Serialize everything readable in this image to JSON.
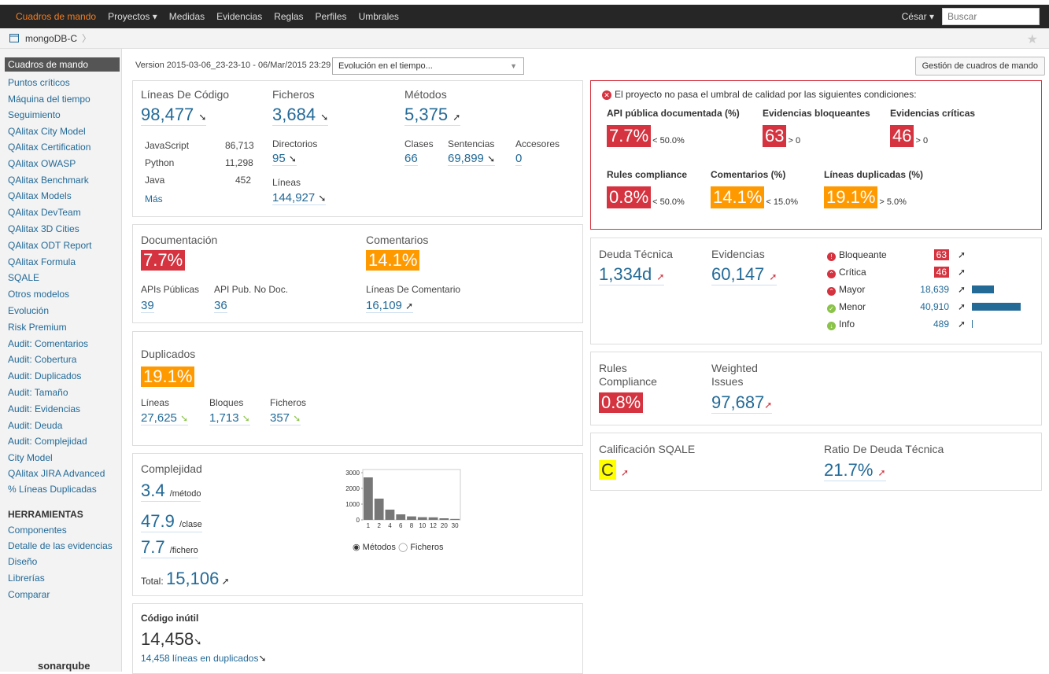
{
  "nav": {
    "home": "Cuadros de mando",
    "items": [
      "Proyectos ▾",
      "Medidas",
      "Evidencias",
      "Reglas",
      "Perfiles",
      "Umbrales"
    ],
    "user": "César ▾",
    "search_placeholder": "Buscar"
  },
  "breadcrumb": {
    "project": "mongoDB-C"
  },
  "sidebar": {
    "items": [
      "Cuadros de mando",
      "Puntos críticos",
      "Máquina del tiempo",
      "Seguimiento",
      "QAlitax City Model",
      "QAlitax Certification",
      "QAlitax OWASP",
      "QAlitax Benchmark",
      "QAlitax Models",
      "QAlitax DevTeam",
      "QAlitax 3D Cities",
      "QAlitax ODT Report",
      "QAlitax Formula",
      "SQALE",
      "Otros modelos",
      "Evolución",
      "Risk Premium",
      "Audit: Comentarios",
      "Audit: Cobertura",
      "Audit: Duplicados",
      "Audit: Tamaño",
      "Audit: Evidencias",
      "Audit: Deuda",
      "Audit: Complejidad",
      "City Model",
      "QAlitax JIRA Advanced",
      "% Líneas Duplicadas"
    ],
    "tools_title": "HERRAMIENTAS",
    "tools": [
      "Componentes",
      "Detalle de las evidencias",
      "Diseño",
      "Librerías",
      "Comparar"
    ],
    "logo": "sonarqube"
  },
  "toolbar": {
    "version": "Version 2015-03-06_23-23-10 - 06/Mar/2015 23:29",
    "select": "Evolución en el tiempo...",
    "manage": "Gestión de cuadros de mando"
  },
  "size": {
    "loc_label": "Líneas De Código",
    "loc": "98,477",
    "files_label": "Ficheros",
    "files": "3,684",
    "methods_label": "Métodos",
    "methods": "5,375",
    "langs": [
      {
        "name": "JavaScript",
        "value": "86,713"
      },
      {
        "name": "Python",
        "value": "11,298"
      },
      {
        "name": "Java",
        "value": "452"
      }
    ],
    "more": "Más",
    "dirs_label": "Directorios",
    "dirs": "95",
    "lines_label": "Líneas",
    "lines": "144,927",
    "classes_label": "Clases",
    "classes": "66",
    "stmts_label": "Sentencias",
    "stmts": "69,899",
    "acc_label": "Accesores",
    "acc": "0"
  },
  "doc": {
    "title": "Documentación",
    "value": "7.7%",
    "comments_title": "Comentarios",
    "comments": "14.1%",
    "api_label": "APIs Públicas",
    "api": "39",
    "undoc_label": "API Pub. No Doc.",
    "undoc": "36",
    "comment_lines_label": "Líneas De Comentario",
    "comment_lines": "16,109"
  },
  "dup": {
    "title": "Duplicados",
    "value": "19.1%",
    "lines_label": "Líneas",
    "lines": "27,625",
    "blocks_label": "Bloques",
    "blocks": "1,713",
    "files_label": "Ficheros",
    "files": "357"
  },
  "complexity": {
    "title": "Complejidad",
    "per_method": "3.4",
    "per_method_unit": "/método",
    "per_class": "47.9",
    "per_class_unit": "/clase",
    "per_file": "7.7",
    "per_file_unit": "/fichero",
    "total_label": "Total:",
    "total": "15,106",
    "radio1": "Métodos",
    "radio2": "Ficheros"
  },
  "dead": {
    "title": "Código inútil",
    "value": "14,458",
    "dup_lines": "14,458 líneas en duplicados"
  },
  "alert": {
    "message": "El proyecto no pasa el umbral de calidad por las siguientes condiciones:",
    "conditions": [
      {
        "title": "API pública documentada (%)",
        "value": "7.7%",
        "threshold": "< 50.0%",
        "color": "#d4333f"
      },
      {
        "title": "Evidencias bloqueantes",
        "value": "63",
        "threshold": "> 0",
        "color": "#d4333f"
      },
      {
        "title": "Evidencias críticas",
        "value": "46",
        "threshold": "> 0",
        "color": "#d4333f"
      },
      {
        "title": "Rules compliance",
        "value": "0.8%",
        "threshold": "< 50.0%",
        "color": "#d4333f"
      },
      {
        "title": "Comentarios (%)",
        "value": "14.1%",
        "threshold": "< 15.0%",
        "color": "#f90"
      },
      {
        "title": "Líneas duplicadas (%)",
        "value": "19.1%",
        "threshold": "> 5.0%",
        "color": "#f90"
      }
    ]
  },
  "debt": {
    "label": "Deuda Técnica",
    "value": "1,334d",
    "issues_label": "Evidencias",
    "issues": "60,147",
    "severities": [
      {
        "name": "Bloqueante",
        "count": "63",
        "share": 0,
        "color": "#d4333f"
      },
      {
        "name": "Crítica",
        "count": "46",
        "share": 0,
        "color": "#d4333f"
      },
      {
        "name": "Mayor",
        "count": "18,639",
        "share": 0.456,
        "color": "#d4333f"
      },
      {
        "name": "Menor",
        "count": "40,910",
        "share": 1,
        "color": "#8bc34a"
      },
      {
        "name": "Info",
        "count": "489",
        "share": 0.012,
        "color": "#8bc34a"
      }
    ]
  },
  "rules": {
    "label1": "Rules",
    "label2": "Compliance",
    "value": "0.8%",
    "weighted1": "Weighted",
    "weighted2": "Issues",
    "weighted": "97,687"
  },
  "sqale": {
    "label": "Calificación SQALE",
    "value": "C",
    "ratio_label": "Ratio De Deuda Técnica",
    "ratio": "21.7%"
  },
  "chart_data": {
    "type": "bar",
    "categories": [
      "1",
      "2",
      "4",
      "6",
      "8",
      "10",
      "12",
      "20",
      "30"
    ],
    "values": [
      2700,
      1350,
      650,
      350,
      220,
      170,
      160,
      100,
      60
    ],
    "yticks": [
      "3000",
      "2000",
      "1000",
      "0"
    ],
    "ylim": [
      0,
      3200
    ]
  }
}
